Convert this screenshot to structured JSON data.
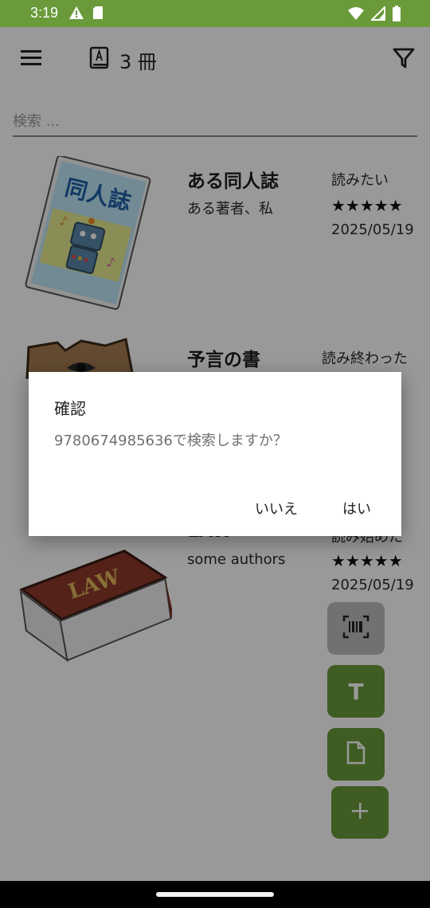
{
  "status_bar": {
    "time": "3:19"
  },
  "app_bar": {
    "count": "3 冊"
  },
  "search": {
    "placeholder": "検索 ..."
  },
  "books": [
    {
      "title": "ある同人誌",
      "author": "ある著者、私",
      "status": "読みたい",
      "rating": "★★★★★",
      "date": "2025/05/19",
      "cover_text": "同人誌"
    },
    {
      "title": "予言の書",
      "author": "",
      "status": "読み終わった",
      "rating": "",
      "date": ""
    },
    {
      "title": "LAW",
      "author": "some authors",
      "status": "読み始めた",
      "rating": "★★★★★",
      "date": "2025/05/19",
      "cover_text": "LAW"
    }
  ],
  "fabs": {
    "text_label": "T"
  },
  "dialog": {
    "title": "確認",
    "message": "9780674985636で検索しますか？",
    "no_label": "いいえ",
    "yes_label": "はい"
  },
  "colors": {
    "accent": "#6a9a3a",
    "fab_disabled": "#bdbdbd"
  }
}
